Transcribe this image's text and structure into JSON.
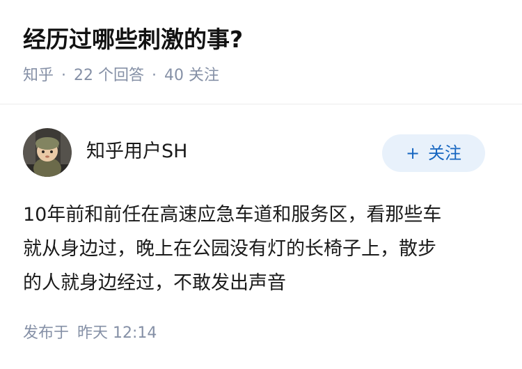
{
  "question": {
    "title": "经历过哪些刺激的事?",
    "source": "知乎",
    "separator": "·",
    "answers_count": "22",
    "answers_label": "个回答",
    "followers_count": "40",
    "followers_label": "关注"
  },
  "answer": {
    "author_name": "知乎用户SH",
    "follow_button": {
      "icon": "+",
      "label": "关注"
    },
    "content_lines": [
      "10年前和前任在高速应急车道和服务区，看那些车",
      "就从身边过，晚上在公园没有灯的长椅子上，散步",
      "的人就身边经过，不敢发出声音"
    ],
    "published_label": "发布于",
    "published_time": "昨天 12:14"
  },
  "colors": {
    "follow_button_bg": "#e8f1fb",
    "follow_button_text": "#1565c0",
    "meta_text": "#8590a6"
  }
}
